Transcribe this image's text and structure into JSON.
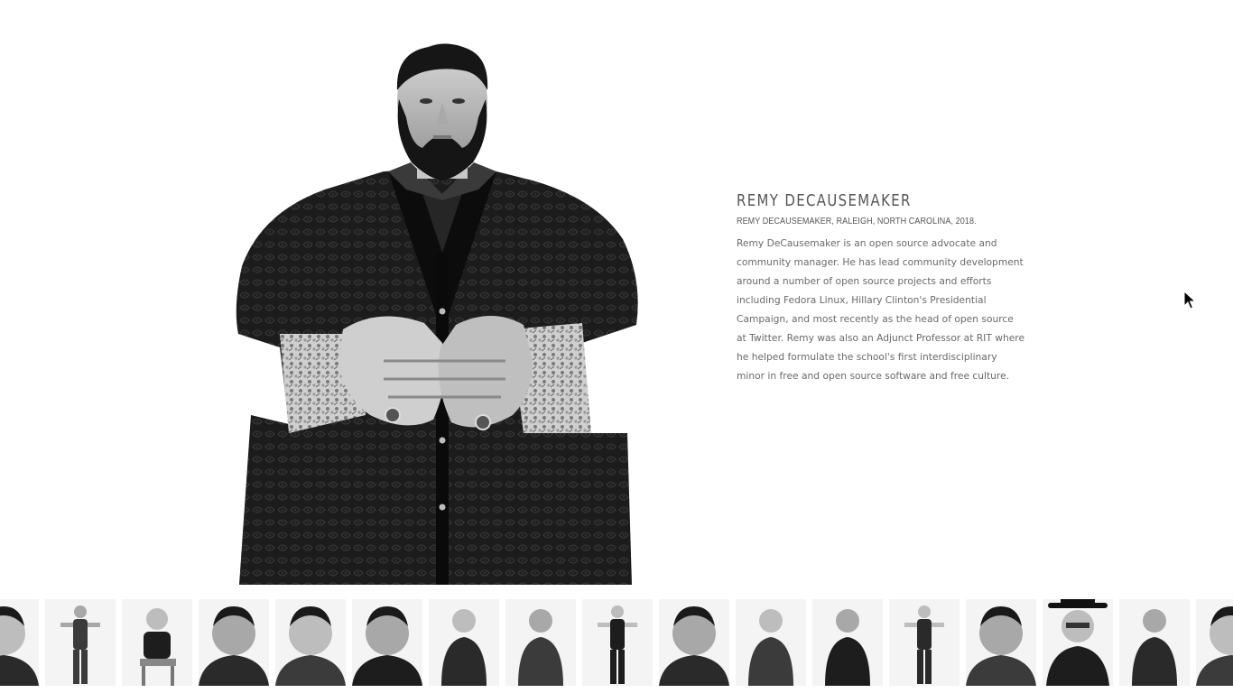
{
  "profile": {
    "name": "REMY DECAUSEMAKER",
    "caption": "REMY DECAUSEMAKER, RALEIGH, NORTH CAROLINA, 2018.",
    "bio": "Remy DeCausemaker is an open source advocate and community manager. He has lead community development around a number of open source projects and efforts including Fedora Linux, Hillary Clinton's Presidential Campaign, and most recently as the head of open source at Twitter. Remy was also an Adjunct Professor at RIT where he helped formulate the school's first interdisciplinary minor in free and open source software and free culture."
  },
  "gallery": {
    "thumbnails": [
      {
        "kind": "bust"
      },
      {
        "kind": "full"
      },
      {
        "kind": "seated"
      },
      {
        "kind": "bust"
      },
      {
        "kind": "bust"
      },
      {
        "kind": "bust"
      },
      {
        "kind": "half"
      },
      {
        "kind": "half"
      },
      {
        "kind": "full"
      },
      {
        "kind": "bust"
      },
      {
        "kind": "half"
      },
      {
        "kind": "half"
      },
      {
        "kind": "full"
      },
      {
        "kind": "bust"
      },
      {
        "kind": "hat"
      },
      {
        "kind": "half"
      },
      {
        "kind": "bust"
      }
    ]
  },
  "colors": {
    "background": "#ffffff",
    "heading": "#555555",
    "body_text": "#6a6a6a",
    "photo_dark": "#141414"
  },
  "icons": {
    "cursor": "arrow-cursor-icon"
  }
}
